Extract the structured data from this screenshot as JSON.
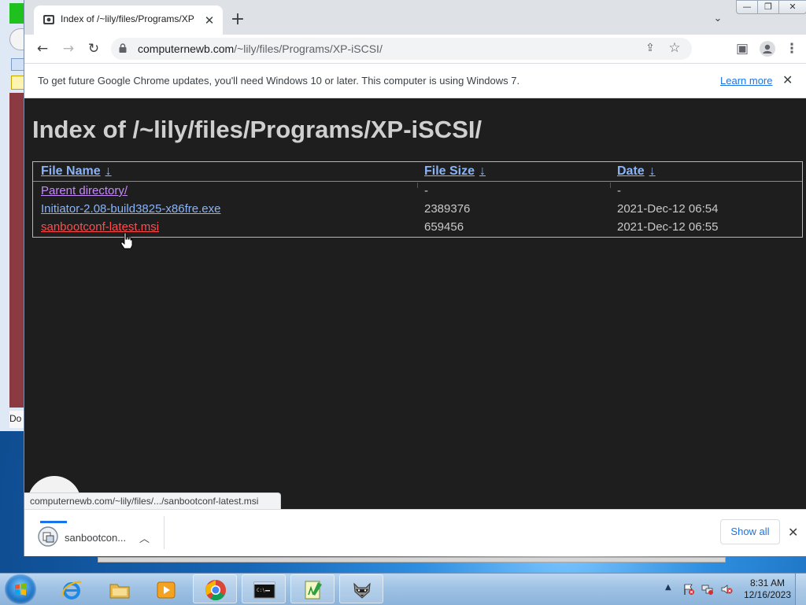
{
  "browser": {
    "tab": {
      "title": "Index of /~lily/files/Programs/XP"
    },
    "url": {
      "host": "computernewb.com",
      "path": "/~lily/files/Programs/XP-iSCSI/"
    },
    "infobar": {
      "message": "To get future Google Chrome updates, you'll need Windows 10 or later. This computer is using Windows 7.",
      "link": "Learn more"
    }
  },
  "page": {
    "heading": "Index of /~lily/files/Programs/XP-iSCSI/",
    "columns": {
      "name": "File Name",
      "size": "File Size",
      "date": "Date",
      "sort_arrow": "↓"
    },
    "rows": [
      {
        "name": "Parent directory/",
        "size": "-",
        "date": "-"
      },
      {
        "name": "Initiator-2.08-build3825-x86fre.exe",
        "size": "2389376",
        "date": "2021-Dec-12 06:54"
      },
      {
        "name": "sanbootconf-latest.msi",
        "size": "659456",
        "date": "2021-Dec-12 06:55"
      }
    ]
  },
  "status_url": "computernewb.com/~lily/files/.../sanbootconf-latest.msi",
  "downloads": {
    "item_name": "sanbootcon...",
    "show_all": "Show all"
  },
  "background_window": {
    "partial_label": "Do"
  },
  "taskbar": {
    "clock_time": "8:31 AM",
    "clock_date": "12/16/2023",
    "apps": [
      "internet-explorer",
      "file-explorer",
      "media-player",
      "chrome",
      "command-prompt",
      "notepad-editor",
      "raccoon-app"
    ]
  },
  "colors": {
    "link": "#8ab4f8",
    "link_visited": "#c58af9",
    "link_hover": "#ff4d4d",
    "page_bg": "#1e1e1e"
  }
}
